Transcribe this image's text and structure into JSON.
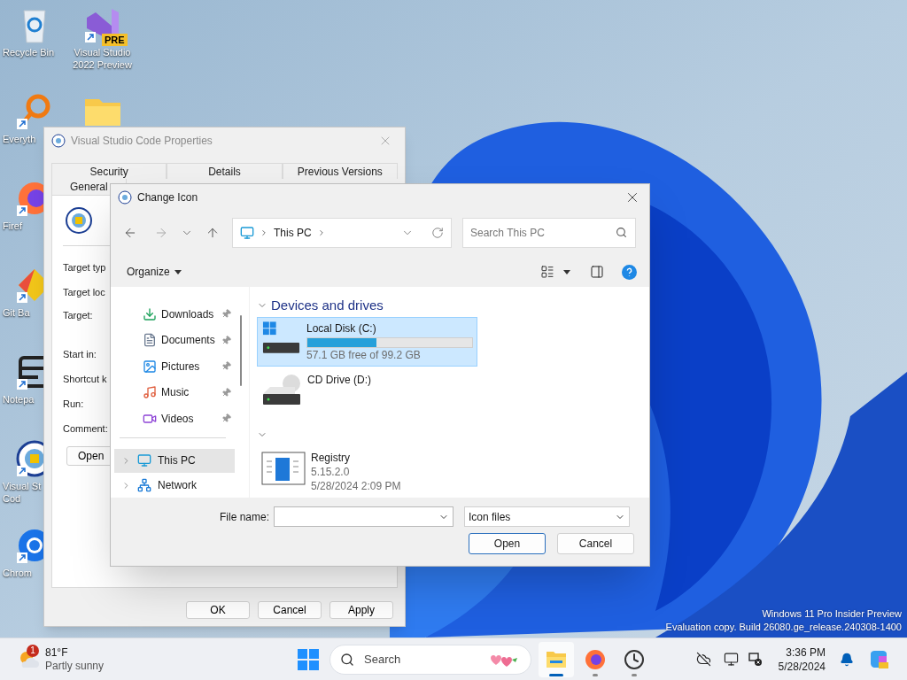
{
  "desktop": {
    "icons": [
      {
        "kind": "recycle",
        "label": [
          "Recycle Bin"
        ]
      },
      {
        "kind": "magnifier",
        "label": [
          "Everyth"
        ]
      },
      {
        "kind": "firefox",
        "label": [
          "Firef"
        ]
      },
      {
        "kind": "git",
        "label": [
          "Git Ba"
        ]
      },
      {
        "kind": "notepad",
        "label": [
          "Notepa"
        ]
      },
      {
        "kind": "crest",
        "label": [
          "Visual St",
          "Cod"
        ]
      },
      {
        "kind": "chrome",
        "label": [
          "Chrom"
        ]
      },
      {
        "kind": "vs",
        "label": [
          "Visual Studio",
          "2022 Preview"
        ],
        "badge": "PRE"
      },
      {
        "kind": "folder"
      }
    ],
    "os_notice": [
      "Windows 11 Pro Insider Preview",
      "Evaluation copy. Build 26080.ge_release.240308-1400"
    ]
  },
  "properties_window": {
    "title": "Visual Studio Code Properties",
    "tabs_back": [
      {
        "label": "Security",
        "selected": false
      },
      {
        "label": "Details",
        "selected": false
      },
      {
        "label": "Previous Versions",
        "selected": false
      }
    ],
    "tabs_front": [
      {
        "label": "General",
        "selected": false
      }
    ],
    "field_labels": [
      "Target typ",
      "Target loc",
      "Target:",
      "Start in:",
      "Shortcut k",
      "Run:",
      "Comment:"
    ],
    "open_button": "Open",
    "buttons": [
      "OK",
      "Cancel",
      "Apply"
    ]
  },
  "change_icon": {
    "title": "Change Icon",
    "address": [
      "This PC"
    ],
    "search": {
      "placeholder": "Search This PC"
    },
    "organize": "Organize",
    "quick_access": [
      {
        "kind": "downloads",
        "label": "Downloads",
        "pinned": true
      },
      {
        "kind": "documents",
        "label": "Documents",
        "pinned": true
      },
      {
        "kind": "pictures",
        "label": "Pictures",
        "pinned": true
      },
      {
        "kind": "music",
        "label": "Music",
        "pinned": true
      },
      {
        "kind": "videos",
        "label": "Videos",
        "pinned": true
      }
    ],
    "tree": [
      {
        "kind": "pc",
        "label": "This PC",
        "selected": true
      },
      {
        "kind": "network",
        "label": "Network",
        "selected": false
      }
    ],
    "groups": [
      {
        "title": "Devices and drives",
        "expanded": true,
        "items": [
          {
            "kind": "system_drive",
            "name": "Local Disk (C:)",
            "level": 0.42,
            "detail": "57.1 GB free of 99.2 GB",
            "selected": true
          },
          {
            "kind": "cd_drive",
            "name": "CD Drive (D:)",
            "selected": false
          }
        ]
      },
      {
        "expanded": true,
        "items": [
          {
            "kind": "file",
            "name": "Registry",
            "lines": [
              "5.15.2.0",
              "5/28/2024 2:09 PM"
            ],
            "selected": false
          }
        ]
      }
    ],
    "file_name": {
      "label": "File name:"
    },
    "file_type": {
      "value": "Icon files"
    },
    "buttons": [
      "Open",
      "Cancel"
    ]
  },
  "taskbar": {
    "weather": {
      "temp": "81°F",
      "condition": "Partly sunny",
      "badge": "1"
    },
    "search": {
      "placeholder": "Search"
    },
    "apps": [
      {
        "kind": "explorer",
        "active": true
      },
      {
        "kind": "firefox",
        "active": false
      },
      {
        "kind": "clock",
        "active": false
      }
    ],
    "time": "3:36 PM",
    "date": "5/28/2024"
  }
}
